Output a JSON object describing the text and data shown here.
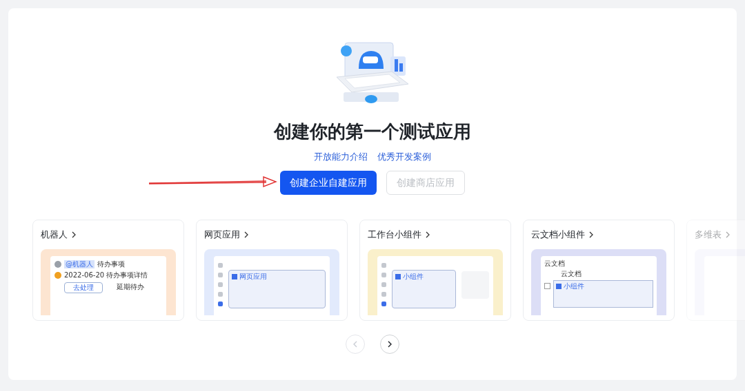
{
  "heading": "创建你的第一个测试应用",
  "links": [
    "开放能力介绍",
    "优秀开发案例"
  ],
  "buttons": [
    {
      "label": "创建企业自建应用",
      "disabled": false
    },
    {
      "label": "创建商店应用",
      "disabled": true
    }
  ],
  "cards": [
    {
      "title": "机器人",
      "kind": "robot",
      "color": "#fde5d1",
      "texts": [
        "@机器人",
        "待办事项",
        "2022-06-20 待办事项详情",
        "去处理",
        "延期待办"
      ]
    },
    {
      "title": "网页应用",
      "kind": "web",
      "color": "#e2eafc",
      "texts": [
        "网页应用"
      ]
    },
    {
      "title": "工作台小组件",
      "kind": "workbench",
      "color": "#faf0cb",
      "texts": [
        "小组件"
      ]
    },
    {
      "title": "云文档小组件",
      "kind": "doc",
      "color": "#dcdef6",
      "texts": [
        "云文档",
        "云文档",
        "小组件"
      ]
    },
    {
      "title": "多维表",
      "kind": "faded",
      "color": "#eeeefb"
    }
  ],
  "pager": [
    {
      "kind": "prev",
      "disabled": true
    },
    {
      "kind": "next",
      "disabled": false
    }
  ]
}
